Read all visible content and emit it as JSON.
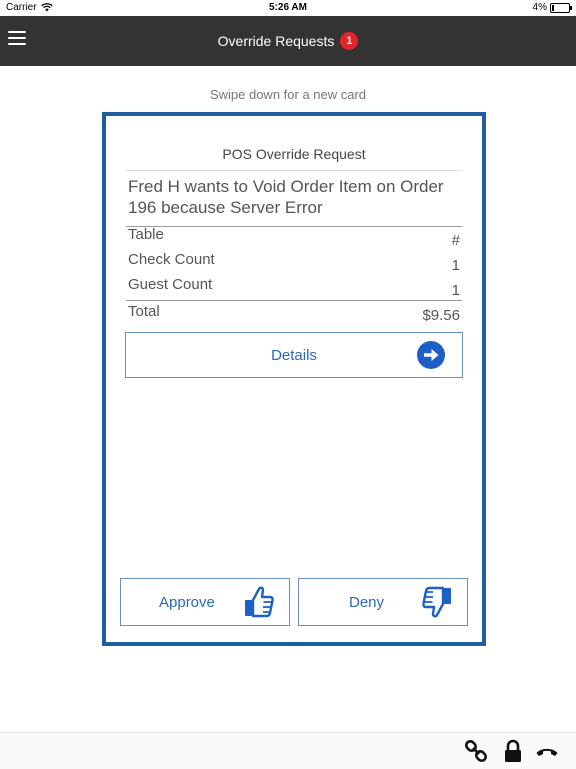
{
  "status_bar": {
    "carrier": "Carrier",
    "time": "5:26 AM",
    "battery": "4%"
  },
  "nav": {
    "title": "Override Requests",
    "badge_count": "1"
  },
  "hint": "Swipe down for a new card",
  "card": {
    "title": "POS Override Request",
    "description": "Fred H wants to Void Order Item on Order 196 because Server Error",
    "rows": [
      {
        "label": "Table",
        "value": "#"
      },
      {
        "label": "Check Count",
        "value": "1"
      },
      {
        "label": "Guest Count",
        "value": "1"
      }
    ],
    "total": {
      "label": "Total",
      "value": "$9.56"
    },
    "details_label": "Details",
    "approve_label": "Approve",
    "deny_label": "Deny"
  },
  "icons": {
    "menu": "hamburger-menu-icon",
    "details": "arrow-right-circle-icon",
    "approve": "thumbs-up-icon",
    "deny": "thumbs-down-icon",
    "link": "link-icon",
    "lock": "lock-icon",
    "phone": "phone-hangup-icon"
  },
  "colors": {
    "nav_bg": "#333333",
    "accent": "#2a6ab8",
    "card_border": "#1f5fa0",
    "badge": "#e0262b"
  }
}
